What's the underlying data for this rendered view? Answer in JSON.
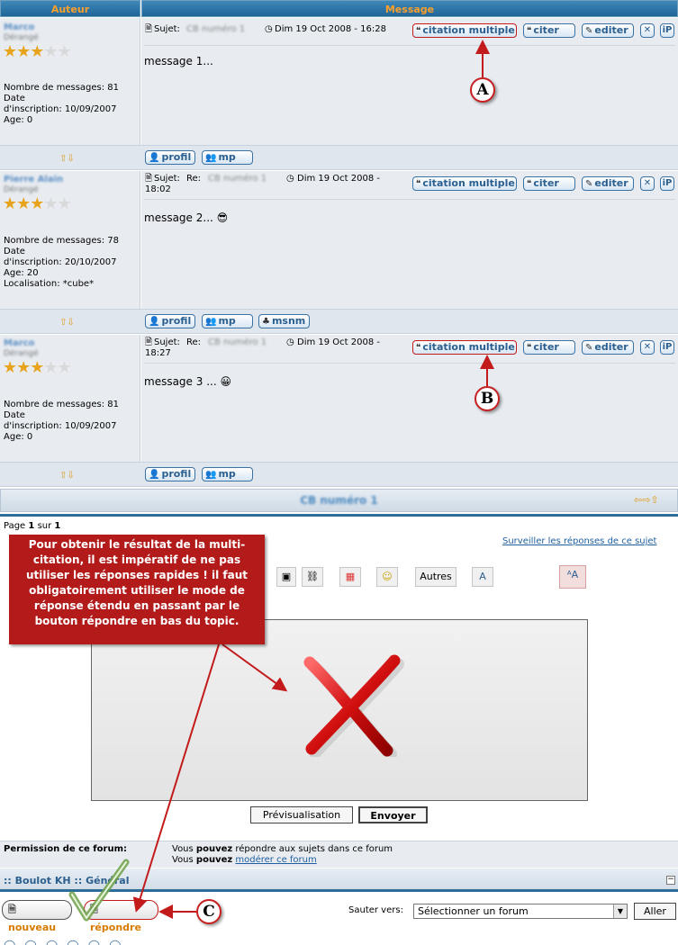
{
  "header": {
    "author_col": "Auteur",
    "message_col": "Message"
  },
  "posts": [
    {
      "author": "Marco",
      "rank": "Dérangé",
      "stars": "★★★☆☆",
      "stats": "Nombre de messages: 81\nDate\nd'inscription: 10/09/2007\nAge: 0",
      "subject_label": "Sujet:",
      "subject_prefix": "",
      "subject_blur": "CB numéro 1",
      "date": "Dim 19 Oct 2008 - 16:28",
      "body": "message 1...",
      "smiley": ""
    },
    {
      "author": "Pierre Alain",
      "rank": "Dérangé",
      "stars": "★★★☆☆",
      "stats": "Nombre de messages: 78\nDate\nd'inscription: 20/10/2007\nAge: 20\nLocalisation: *cube*",
      "subject_label": "Sujet:",
      "subject_prefix": "Re:",
      "subject_blur": "CB numéro 1",
      "date": "Dim 19 Oct 2008 -",
      "date2": "18:02",
      "body": "message 2...",
      "smiley": "😎"
    },
    {
      "author": "Marco",
      "rank": "Dérangé",
      "stars": "★★★☆☆",
      "stats": "Nombre de messages: 81\nDate\nd'inscription: 10/09/2007\nAge: 0",
      "subject_label": "Sujet:",
      "subject_prefix": "Re:",
      "subject_blur": "CB numéro 1",
      "date": "Dim 19 Oct 2008 -",
      "date2": "18:27",
      "body": "message 3 ...",
      "smiley": "😀"
    }
  ],
  "post_buttons": {
    "multiquote": "citation multiple",
    "quote": "citer",
    "edit": "editer",
    "delete": "✕",
    "ip": "iP"
  },
  "profile_buttons": {
    "profile": "profil",
    "pm": "mp",
    "msnm": "msnm"
  },
  "arrow_icons": "⇧⇩",
  "markers": {
    "a": "A",
    "b": "B",
    "c": "C"
  },
  "topic_title": "CB numéro 1",
  "topic_nav_icons": "⇦⇨⇧",
  "pagination": {
    "label": "Page",
    "current": "1",
    "sep": "sur",
    "total": "1"
  },
  "watch_link": "Surveiller les réponses de ce sujet",
  "annotation_note": "Pour obtenir le résultat de la multi-citation, il est impératif de ne pas utiliser les réponses rapides ! il faut obligatoirement utiliser le mode de réponse étendu en passant par le bouton répondre en bas du topic.",
  "editor": {
    "others_button": "Autres",
    "preview_button": "Prévisualisation",
    "send_button": "Envoyer"
  },
  "permissions": {
    "label": "Permission de ce forum:",
    "line1_pre": "Vous",
    "line1_bold": "pouvez",
    "line1_post": "répondre aux sujets dans ce forum",
    "line2_pre": "Vous",
    "line2_bold": "pouvez",
    "line2_link": "modérer ce forum"
  },
  "breadcrumb": {
    "prefix": "::",
    "forum": "Boulot KH",
    "sep": "::",
    "category": "Général"
  },
  "bottom": {
    "new_button": "nouveau",
    "reply_button": "répondre",
    "jump_label": "Sauter vers:",
    "jump_select": "Sélectionner un forum",
    "go_button": "Aller"
  },
  "colors": {
    "accent": "#c31b1b",
    "header": "#2d6d97",
    "orange": "#ffa02a"
  }
}
